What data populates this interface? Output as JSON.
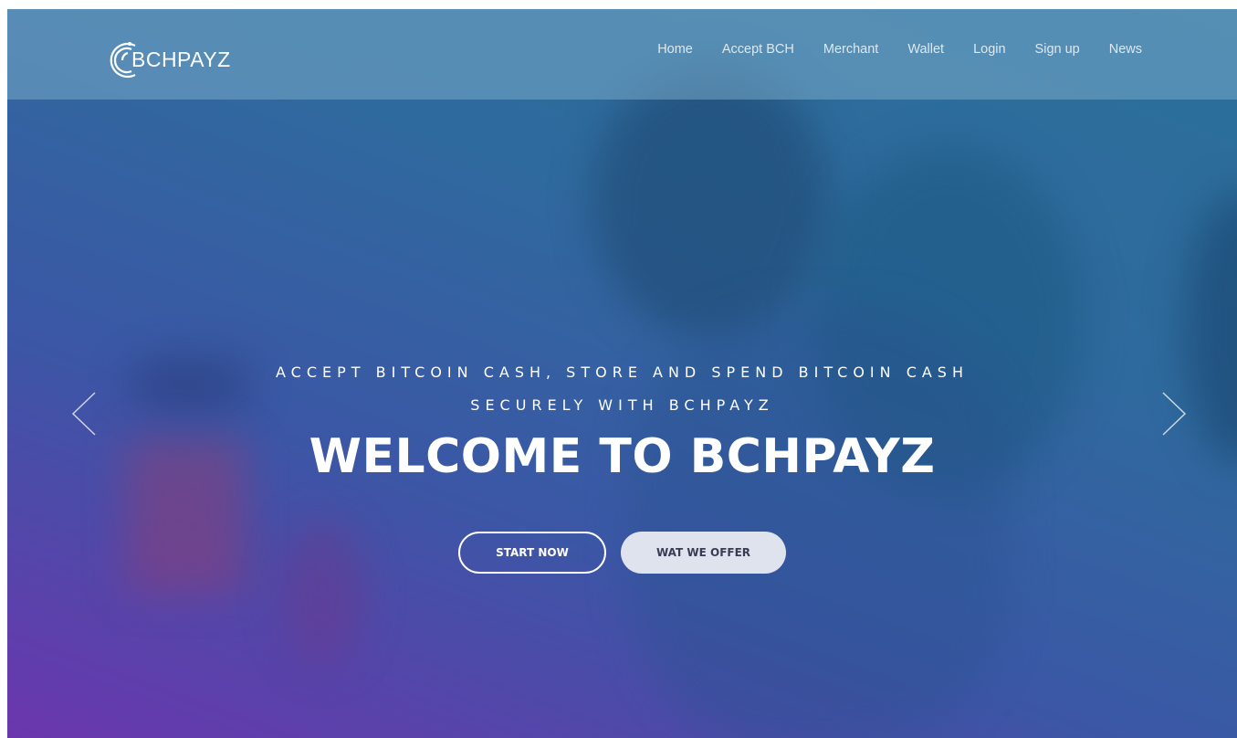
{
  "brand": {
    "logo_text": "BCHPAYZ"
  },
  "nav": {
    "items": [
      {
        "label": "Home"
      },
      {
        "label": "Accept BCH"
      },
      {
        "label": "Merchant"
      },
      {
        "label": "Wallet"
      },
      {
        "label": "Login"
      },
      {
        "label": "Sign up"
      },
      {
        "label": "News"
      }
    ]
  },
  "hero": {
    "tagline_line1": "ACCEPT BITCOIN CASH, STORE AND SPEND BITCOIN CASH",
    "tagline_line2": "SECURELY WITH BCHPAYZ",
    "headline": "WELCOME TO BCHPAYZ",
    "primary_button": "START NOW",
    "secondary_button": "WAT WE OFFER"
  },
  "icons": {
    "logo": "bchpayz-logo-icon",
    "prev": "chevron-left-icon",
    "next": "chevron-right-icon"
  },
  "colors": {
    "gradient_top": "#2b6f9a",
    "gradient_bottom": "#6b36ad",
    "button_fill": "#dfe3ee"
  }
}
